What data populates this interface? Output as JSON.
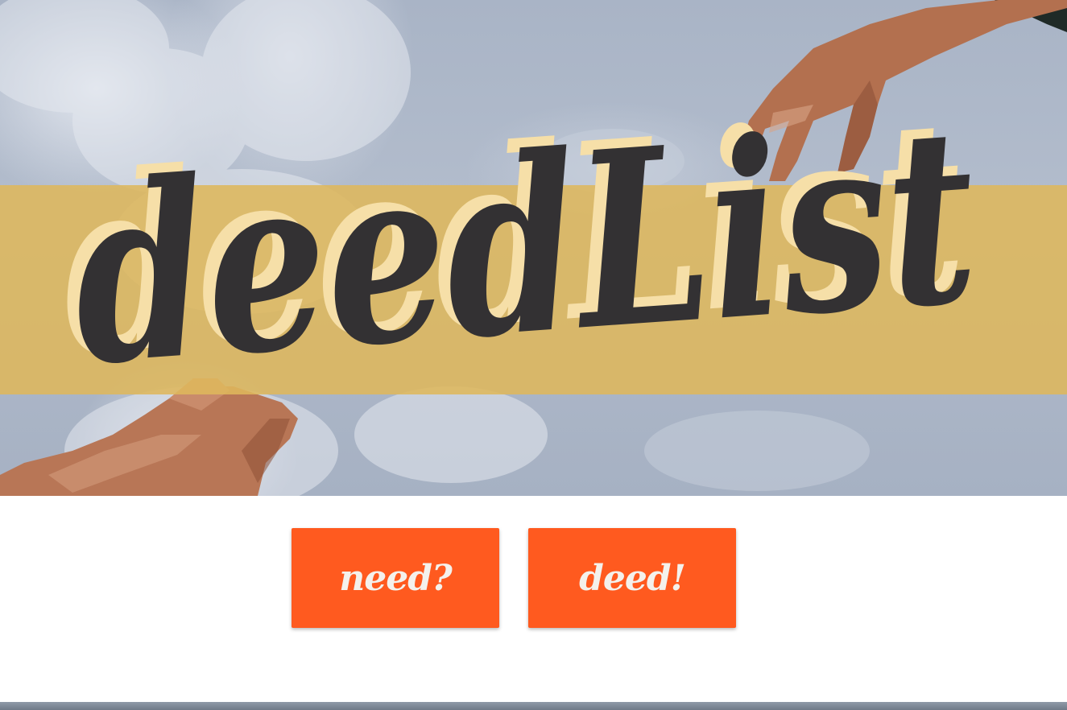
{
  "hero": {
    "logo_text": "deedList",
    "colors": {
      "banner": "#deb75c",
      "logo_fill": "#333133",
      "logo_shadow": "#f6dfa8",
      "sky": "#aeb8c9",
      "skin": "#b9785c"
    }
  },
  "actions": {
    "need_label": "need?",
    "deed_label": "deed!",
    "button_color": "#ff5a1f",
    "button_text_color": "#f4f1ec"
  }
}
